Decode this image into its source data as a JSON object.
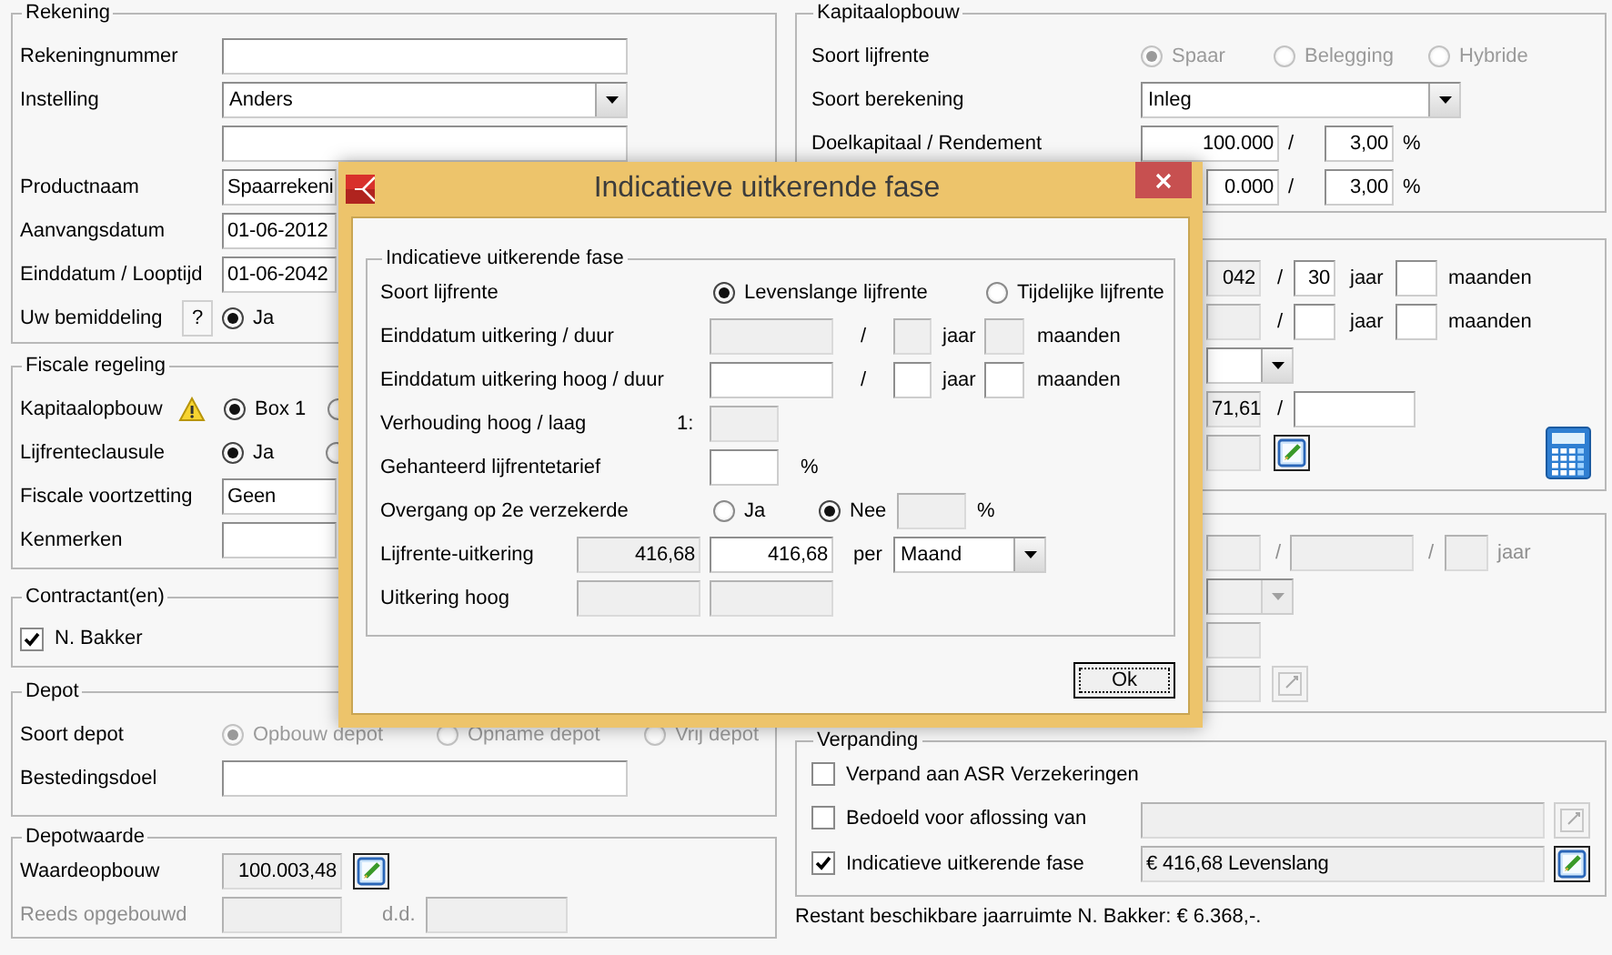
{
  "rekening": {
    "legend": "Rekening",
    "rekeningnummer": {
      "label": "Rekeningnummer",
      "field": {
        "disabled": false
      }
    },
    "instelling": {
      "label": "Instelling",
      "select": {
        "value": "Anders",
        "disabled": false
      },
      "field": {
        "disabled": false
      }
    },
    "productnaam": {
      "label": "Productnaam",
      "field": {
        "value": "Spaarrekeni",
        "disabled": false
      }
    },
    "aanvangsdatum": {
      "label": "Aanvangsdatum",
      "field": {
        "value": "01-06-2012",
        "disabled": false
      }
    },
    "einddatum": {
      "label": "Einddatum / Looptijd",
      "field": {
        "value": "01-06-2042",
        "disabled": false
      }
    },
    "bemiddeling": {
      "label": "Uw bemiddeling",
      "help": "?",
      "radios": {
        "disabled": false,
        "options": [
          {
            "label": "Ja",
            "selected": true
          }
        ]
      }
    }
  },
  "fiscale_regeling": {
    "legend": "Fiscale regeling",
    "kapitaalopbouw": {
      "label": "Kapitaalopbouw",
      "warning": true,
      "radios": {
        "disabled": false,
        "options": [
          {
            "label": "Box 1",
            "selected": true
          },
          {
            "selected": false
          }
        ]
      }
    },
    "lijfrenteclausule": {
      "label": "Lijfrenteclausule",
      "radios": {
        "disabled": false,
        "options": [
          {
            "label": "Ja",
            "selected": true
          },
          {
            "selected": false
          }
        ]
      }
    },
    "fiscale_voortzetting": {
      "label": "Fiscale voortzetting",
      "field": {
        "value": "Geen",
        "disabled": false
      }
    },
    "kenmerken": {
      "label": "Kenmerken",
      "field": {
        "disabled": false
      }
    }
  },
  "contractanten": {
    "legend": "Contractant(en)",
    "items": [
      {
        "label": "N. Bakker",
        "checked": true
      }
    ]
  },
  "depot": {
    "legend": "Depot",
    "soort_depot": {
      "label": "Soort depot",
      "radios": {
        "disabled": true,
        "options": [
          {
            "label": "Opbouw depot",
            "selected": true
          },
          {
            "label": "Opname depot",
            "selected": false
          },
          {
            "label": "Vrij depot",
            "selected": false
          }
        ]
      }
    },
    "bestedingsdoel": {
      "label": "Bestedingsdoel",
      "field": {
        "disabled": false
      }
    }
  },
  "depotwaarde": {
    "legend": "Depotwaarde",
    "waardeopbouw": {
      "label": "Waardeopbouw",
      "field": {
        "value": "100.003,48",
        "disabled": true
      },
      "edit": {
        "disabled": false
      }
    },
    "reeds_opgebouwd": {
      "label": "Reeds opgebouwd",
      "disabled": true,
      "field": {
        "disabled": true
      },
      "date_label": "d.d.",
      "date_field": {
        "disabled": true
      }
    }
  },
  "kapitaalopbouw": {
    "legend": "Kapitaalopbouw",
    "soort_lijfrente": {
      "label": "Soort lijfrente",
      "radios": {
        "disabled": true,
        "options": [
          {
            "label": "Spaar",
            "selected": true
          },
          {
            "label": "Belegging",
            "selected": false
          },
          {
            "label": "Hybride",
            "selected": false
          }
        ]
      }
    },
    "soort_berekening": {
      "label": "Soort berekening",
      "select": {
        "value": "Inleg",
        "disabled": false
      }
    },
    "doelkapitaal": {
      "label": "Doelkapitaal / Rendement",
      "field": {
        "value": "100.000",
        "disabled": false
      },
      "separator": "/",
      "rate": {
        "value": "3,00",
        "disabled": false
      },
      "unit": "%"
    },
    "row_4": {
      "field": {
        "value": "0.000",
        "disabled": false
      },
      "separator": "/",
      "rate": {
        "value": "3,00",
        "disabled": false
      },
      "unit": "%"
    }
  },
  "panel_2": {
    "calculator": true,
    "rows": [
      {
        "kind": "duration",
        "field": {
          "value": "042",
          "disabled": true
        },
        "separator": "/",
        "years": {
          "value": "30",
          "disabled": false
        },
        "years_unit": "jaar",
        "months": {
          "disabled": false
        },
        "months_unit": "maanden"
      },
      {
        "kind": "duration",
        "field": {
          "disabled": true
        },
        "separator": "/",
        "years": {
          "disabled": false
        },
        "years_unit": "jaar",
        "months": {
          "disabled": false
        },
        "months_unit": "maanden"
      },
      {
        "kind": "select",
        "select": {
          "disabled": false
        }
      },
      {
        "kind": "pair",
        "field": {
          "value": "71,61",
          "disabled": true
        },
        "separator": "/",
        "second": {
          "disabled": false
        }
      },
      {
        "kind": "edit",
        "field": {
          "disabled": true
        },
        "edit": {
          "disabled": false
        }
      }
    ]
  },
  "panel_3": {
    "rows": [
      {
        "kind": "triple",
        "disabled": true,
        "field": {
          "disabled": true
        },
        "separator": "/",
        "second": {
          "disabled": true
        },
        "separator_2": "/",
        "third": {
          "disabled": true
        },
        "unit": "jaar"
      },
      {
        "kind": "select",
        "select": {
          "disabled": true
        }
      },
      {
        "kind": "field",
        "field": {
          "disabled": true
        }
      },
      {
        "kind": "edit",
        "field": {
          "disabled": true
        },
        "edit": {
          "disabled": true
        }
      }
    ]
  },
  "verpanding": {
    "legend": "Verpanding",
    "items": [
      {
        "label": "Verpand aan ASR Verzekeringen",
        "checked": false
      },
      {
        "label": "Bedoeld voor aflossing van",
        "checked": false,
        "field": {
          "disabled": true
        },
        "edit": {
          "disabled": true
        }
      },
      {
        "label": "Indicatieve uitkerende fase",
        "checked": true,
        "field": {
          "value": "€ 416,68 Levenslang",
          "disabled": true
        },
        "edit": {
          "disabled": false
        }
      }
    ]
  },
  "footer_note": "Restant beschikbare jaarruimte N. Bakker: € 6.368,-.",
  "dialog": {
    "title": "Indicatieve uitkerende fase",
    "legend": "Indicatieve uitkerende fase",
    "soort_lijfrente": {
      "label": "Soort lijfrente",
      "options": [
        {
          "label": "Levenslange lijfrente",
          "selected": true
        },
        {
          "label": "Tijdelijke lijfrente",
          "selected": false
        }
      ]
    },
    "einddatum": {
      "label": "Einddatum uitkering / duur",
      "date": {
        "disabled": true
      },
      "separator": "/",
      "years": {
        "disabled": true
      },
      "years_unit": "jaar",
      "months": {
        "disabled": true
      },
      "months_unit": "maanden"
    },
    "einddatum_hoog": {
      "label": "Einddatum uitkering hoog / duur",
      "date": {
        "disabled": false
      },
      "separator": "/",
      "years": {
        "disabled": false
      },
      "years_unit": "jaar",
      "months": {
        "disabled": false
      },
      "months_unit": "maanden"
    },
    "verhouding": {
      "label": "Verhouding hoog / laag",
      "prefix": "1:",
      "field": {
        "disabled": true
      }
    },
    "tarief": {
      "label": "Gehanteerd lijfrentetarief",
      "field": {
        "disabled": false
      },
      "unit": "%"
    },
    "overgang": {
      "label": "Overgang op 2e verzekerde",
      "options": [
        {
          "label": "Ja",
          "selected": false
        },
        {
          "label": "Nee",
          "selected": true
        }
      ],
      "field": {
        "disabled": true
      },
      "unit": "%"
    },
    "uitkering": {
      "label": "Lijfrente-uitkering",
      "calculated": {
        "value": "416,68",
        "disabled": true
      },
      "field": {
        "value": "416,68",
        "disabled": false
      },
      "per": "per",
      "select": {
        "value": "Maand",
        "disabled": false
      }
    },
    "uitkering_hoog": {
      "label": "Uitkering hoog",
      "calculated": {
        "disabled": true
      },
      "field": {
        "disabled": true
      }
    },
    "ok": "Ok"
  }
}
